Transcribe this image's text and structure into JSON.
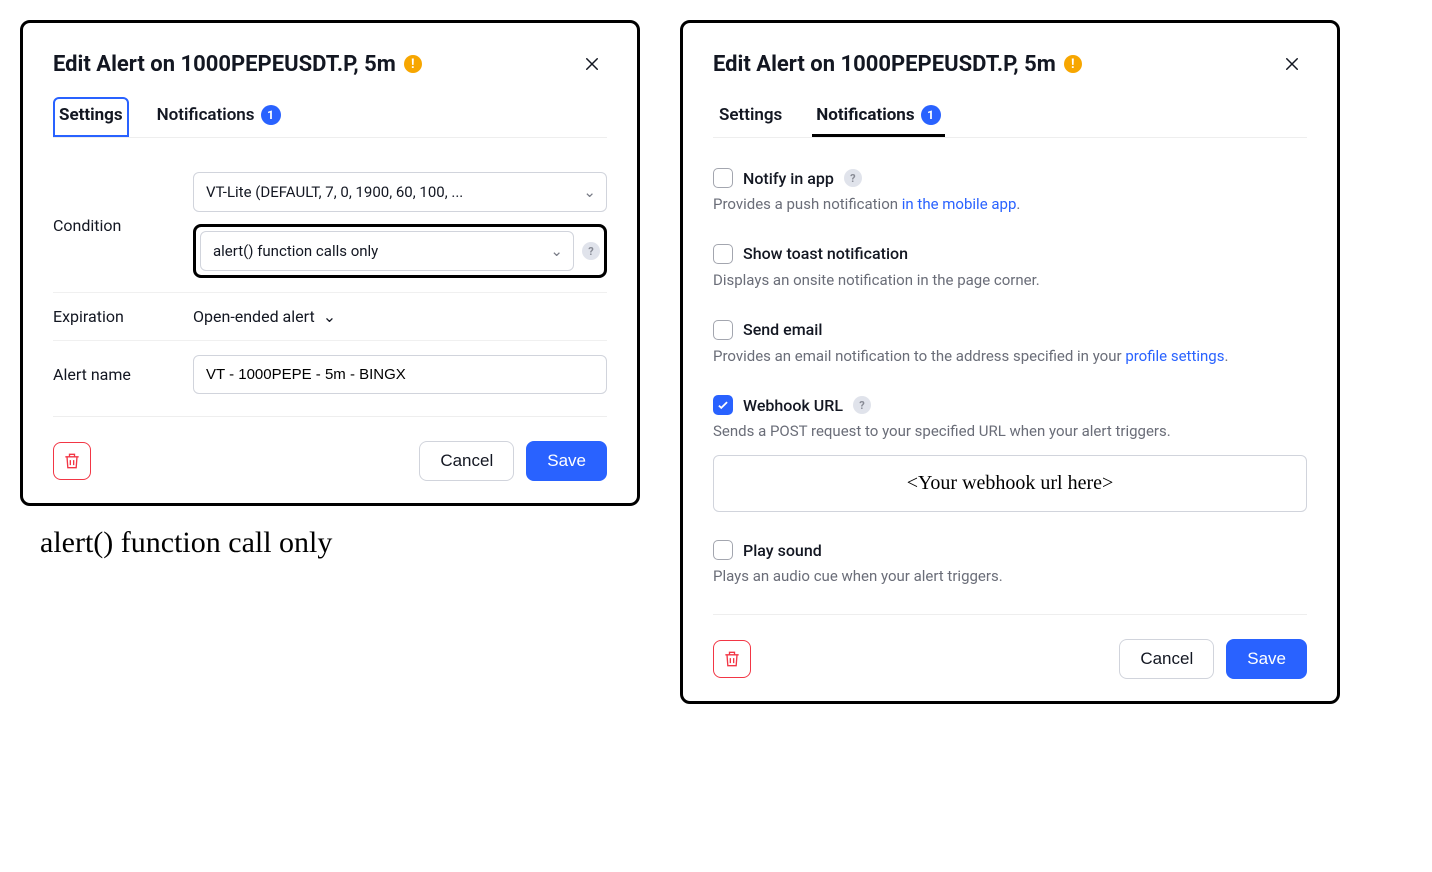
{
  "left": {
    "title": "Edit Alert on 1000PEPEUSDT.P, 5m",
    "tabs": {
      "settings": "Settings",
      "notifications": "Notifications",
      "badge": "1"
    },
    "condition": {
      "label": "Condition",
      "option1": "VT-Lite (DEFAULT, 7, 0, 1900, 60, 100, ...",
      "option2": "alert() function calls only"
    },
    "expiration": {
      "label": "Expiration",
      "value": "Open-ended alert"
    },
    "alert_name": {
      "label": "Alert name",
      "value": "VT - 1000PEPE - 5m - BINGX"
    },
    "buttons": {
      "cancel": "Cancel",
      "save": "Save"
    }
  },
  "handnote": "alert() function call only",
  "right": {
    "title": "Edit Alert on 1000PEPEUSDT.P, 5m",
    "tabs": {
      "settings": "Settings",
      "notifications": "Notifications",
      "badge": "1"
    },
    "notify_app": {
      "label": "Notify in app",
      "desc_prefix": "Provides a push notification ",
      "desc_link": "in the mobile app",
      "desc_suffix": ".",
      "checked": false
    },
    "toast": {
      "label": "Show toast notification",
      "desc": "Displays an onsite notification in the page corner.",
      "checked": false
    },
    "email": {
      "label": "Send email",
      "desc_prefix": "Provides an email notification to the address specified in your ",
      "desc_link": "profile settings",
      "desc_suffix": ".",
      "checked": false
    },
    "webhook": {
      "label": "Webhook URL",
      "desc": "Sends a POST request to your specified URL when your alert triggers.",
      "placeholder": "<Your webhook url here>",
      "checked": true
    },
    "sound": {
      "label": "Play sound",
      "desc": "Plays an audio cue when your alert triggers.",
      "checked": false
    },
    "buttons": {
      "cancel": "Cancel",
      "save": "Save"
    }
  }
}
